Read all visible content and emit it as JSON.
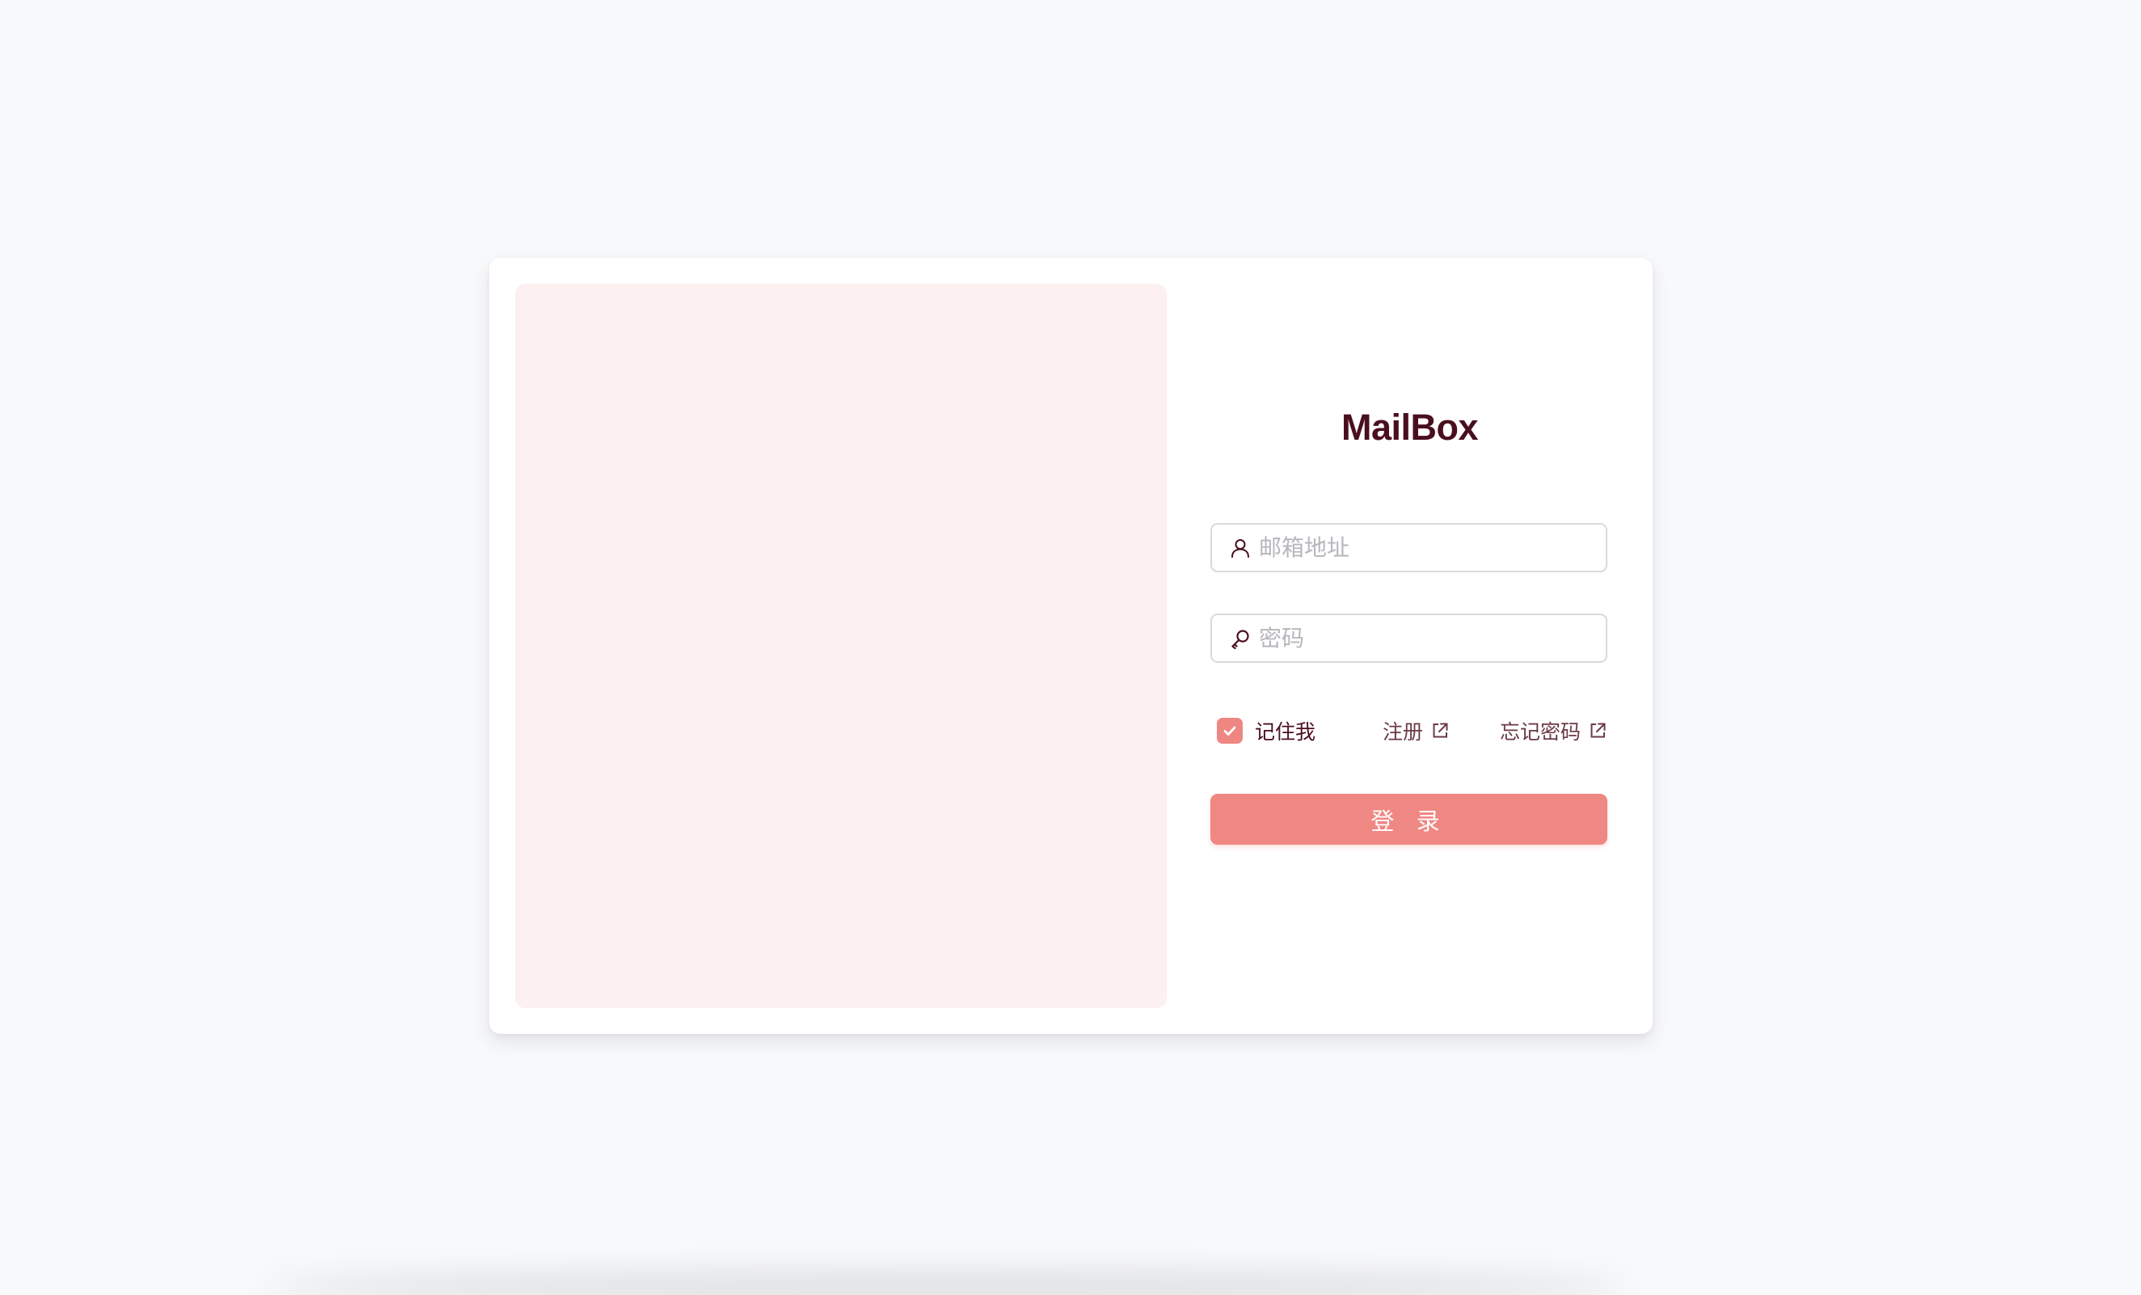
{
  "app": {
    "brand": "MailBox"
  },
  "form": {
    "email_placeholder": "邮箱地址",
    "email_value": "",
    "password_placeholder": "密码",
    "password_value": "",
    "remember_label": "记住我",
    "remember_checked": true,
    "register_label": "注册",
    "forgot_label": "忘记密码",
    "login_label": "登 录"
  },
  "icons": {
    "email": "user-icon",
    "password": "key-icon",
    "checkbox": "check-icon",
    "register": "external-link-icon",
    "forgot": "external-link-icon"
  },
  "colors": {
    "accent": "#ef8783",
    "brand_text": "#4a0f1e",
    "hero_panel": "#fcf1f0",
    "page_background": "#f8f9fb"
  }
}
